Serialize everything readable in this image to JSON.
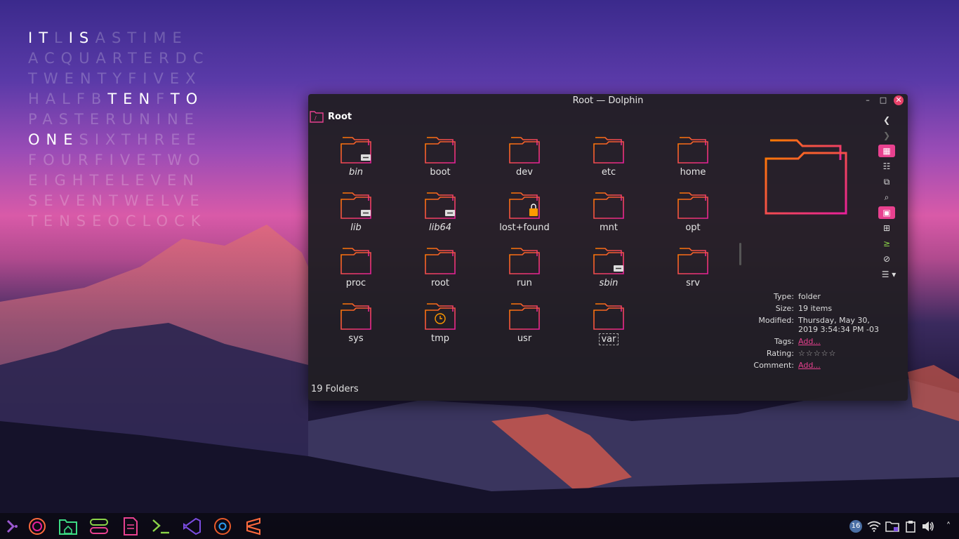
{
  "wordclock": {
    "rows": [
      [
        {
          "t": "IT",
          "on": true
        },
        {
          "t": "L",
          "on": false
        },
        {
          "t": "IS",
          "on": true
        },
        {
          "t": "ASTIME",
          "on": false
        }
      ],
      [
        {
          "t": "ACQUARTERDC",
          "on": false
        }
      ],
      [
        {
          "t": "TWENTYFIVEX",
          "on": false
        }
      ],
      [
        {
          "t": "HALFB",
          "on": false
        },
        {
          "t": "TEN",
          "on": true
        },
        {
          "t": "F",
          "on": false
        },
        {
          "t": "TO",
          "on": true
        }
      ],
      [
        {
          "t": "PASTERUNINE",
          "on": false
        }
      ],
      [
        {
          "t": "ONE",
          "on": true
        },
        {
          "t": "SIXTHREE",
          "on": false
        }
      ],
      [
        {
          "t": "FOURFIVETWO",
          "on": false
        }
      ],
      [
        {
          "t": "EIGHTELEVEN",
          "on": false
        }
      ],
      [
        {
          "t": "SEVENTWELVE",
          "on": false
        }
      ],
      [
        {
          "t": "TENSEOCLOCK",
          "on": false
        }
      ]
    ]
  },
  "window": {
    "title": "Root — Dolphin",
    "location": "Root",
    "status": "19 Folders",
    "folders": [
      {
        "name": "bin",
        "italic": true,
        "emblem": "link"
      },
      {
        "name": "boot",
        "italic": false,
        "emblem": ""
      },
      {
        "name": "dev",
        "italic": false,
        "emblem": ""
      },
      {
        "name": "etc",
        "italic": false,
        "emblem": ""
      },
      {
        "name": "home",
        "italic": false,
        "emblem": ""
      },
      {
        "name": "lib",
        "italic": true,
        "emblem": "link"
      },
      {
        "name": "lib64",
        "italic": true,
        "emblem": "link"
      },
      {
        "name": "lost+found",
        "italic": false,
        "emblem": "lock"
      },
      {
        "name": "mnt",
        "italic": false,
        "emblem": ""
      },
      {
        "name": "opt",
        "italic": false,
        "emblem": ""
      },
      {
        "name": "proc",
        "italic": false,
        "emblem": ""
      },
      {
        "name": "root",
        "italic": false,
        "emblem": ""
      },
      {
        "name": "run",
        "italic": false,
        "emblem": ""
      },
      {
        "name": "sbin",
        "italic": true,
        "emblem": "link"
      },
      {
        "name": "srv",
        "italic": false,
        "emblem": ""
      },
      {
        "name": "sys",
        "italic": false,
        "emblem": ""
      },
      {
        "name": "tmp",
        "italic": false,
        "emblem": "clock"
      },
      {
        "name": "usr",
        "italic": false,
        "emblem": ""
      },
      {
        "name": "var",
        "italic": false,
        "emblem": "",
        "selected": true
      }
    ],
    "info": {
      "type_label": "Type:",
      "type_value": "folder",
      "size_label": "Size:",
      "size_value": "19 items",
      "modified_label": "Modified:",
      "modified_value": "Thursday, May 30, 2019 3:54:34 PM -03",
      "tags_label": "Tags:",
      "tags_value": "Add...",
      "rating_label": "Rating:",
      "rating_value": "☆☆☆☆☆",
      "comment_label": "Comment:",
      "comment_value": "Add..."
    }
  },
  "tray": {
    "notifications_count": "16"
  },
  "colors": {
    "accent": "#e8418f",
    "folder_start": "#ff7a00",
    "folder_end": "#e8209a"
  }
}
